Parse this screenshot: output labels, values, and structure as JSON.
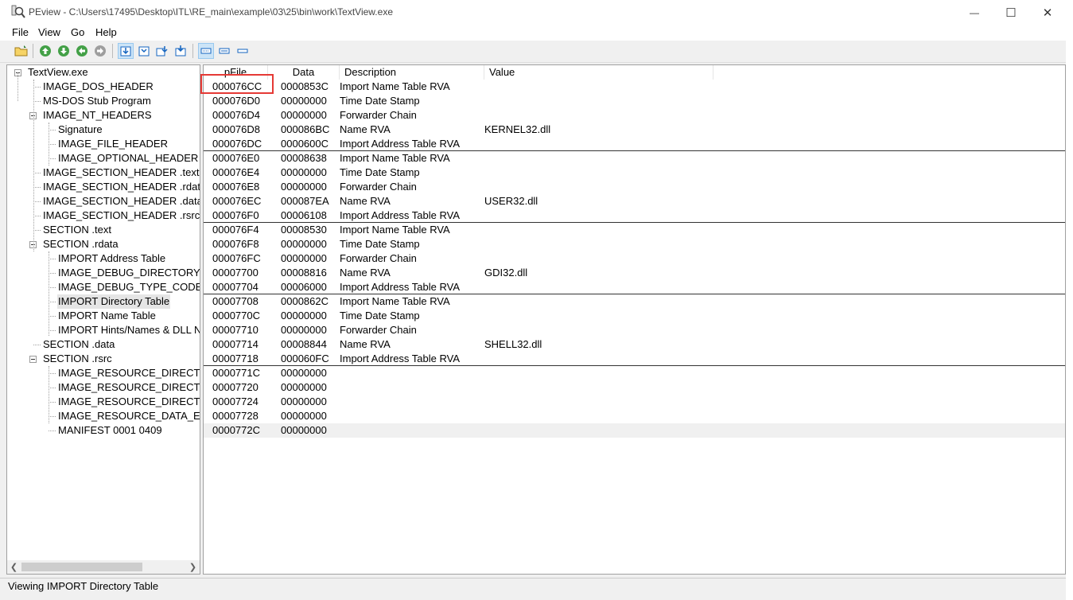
{
  "window": {
    "title": "PEview - C:\\Users\\17495\\Desktop\\ITL\\RE_main\\example\\03\\25\\bin\\work\\TextView.exe",
    "minimize_glyph": "—",
    "maximize_glyph": "☐",
    "close_glyph": "✕"
  },
  "menu": {
    "file": "File",
    "view": "View",
    "go": "Go",
    "help": "Help"
  },
  "toolbar": {
    "icons": [
      "open-folder-icon",
      "go-up-icon",
      "go-down-icon",
      "go-back-icon",
      "go-forward-icon",
      "view-hex-byte-icon",
      "view-hex-word-icon",
      "view-hex-dword-icon",
      "view-hex-qword-icon",
      "view-list-icon",
      "view-small-icon",
      "view-details-icon"
    ],
    "accent": "#2e7d32"
  },
  "tree": {
    "items": [
      {
        "label": "TextView.exe"
      },
      {
        "label": "IMAGE_DOS_HEADER"
      },
      {
        "label": "MS-DOS Stub Program"
      },
      {
        "label": "IMAGE_NT_HEADERS"
      },
      {
        "label": "Signature"
      },
      {
        "label": "IMAGE_FILE_HEADER"
      },
      {
        "label": "IMAGE_OPTIONAL_HEADER"
      },
      {
        "label": "IMAGE_SECTION_HEADER .text"
      },
      {
        "label": "IMAGE_SECTION_HEADER .rdata"
      },
      {
        "label": "IMAGE_SECTION_HEADER .data"
      },
      {
        "label": "IMAGE_SECTION_HEADER .rsrc"
      },
      {
        "label": "SECTION .text"
      },
      {
        "label": "SECTION .rdata"
      },
      {
        "label": "IMPORT Address Table"
      },
      {
        "label": "IMAGE_DEBUG_DIRECTORY"
      },
      {
        "label": "IMAGE_DEBUG_TYPE_CODEVIEW"
      },
      {
        "label": "IMPORT Directory Table"
      },
      {
        "label": "IMPORT Name Table"
      },
      {
        "label": "IMPORT Hints/Names & DLL Names"
      },
      {
        "label": "SECTION .data"
      },
      {
        "label": "SECTION .rsrc"
      },
      {
        "label": "IMAGE_RESOURCE_DIRECTORY Type"
      },
      {
        "label": "IMAGE_RESOURCE_DIRECTORY NameID"
      },
      {
        "label": "IMAGE_RESOURCE_DIRECTORY Language"
      },
      {
        "label": "IMAGE_RESOURCE_DATA_ENTRY"
      },
      {
        "label": "MANIFEST  0001  0409"
      }
    ],
    "selected": "IMPORT Directory Table"
  },
  "list": {
    "columns": [
      "pFile",
      "Data",
      "Description",
      "Value"
    ],
    "rows": [
      {
        "pfile": "000076CC",
        "data": "0000853C",
        "desc": "Import Name Table RVA",
        "value": ""
      },
      {
        "pfile": "000076D0",
        "data": "00000000",
        "desc": "Time Date Stamp",
        "value": ""
      },
      {
        "pfile": "000076D4",
        "data": "00000000",
        "desc": "Forwarder Chain",
        "value": ""
      },
      {
        "pfile": "000076D8",
        "data": "000086BC",
        "desc": "Name RVA",
        "value": "KERNEL32.dll"
      },
      {
        "pfile": "000076DC",
        "data": "0000600C",
        "desc": "Import Address Table RVA",
        "value": ""
      },
      {
        "pfile": "000076E0",
        "data": "00008638",
        "desc": "Import Name Table RVA",
        "value": ""
      },
      {
        "pfile": "000076E4",
        "data": "00000000",
        "desc": "Time Date Stamp",
        "value": ""
      },
      {
        "pfile": "000076E8",
        "data": "00000000",
        "desc": "Forwarder Chain",
        "value": ""
      },
      {
        "pfile": "000076EC",
        "data": "000087EA",
        "desc": "Name RVA",
        "value": "USER32.dll"
      },
      {
        "pfile": "000076F0",
        "data": "00006108",
        "desc": "Import Address Table RVA",
        "value": ""
      },
      {
        "pfile": "000076F4",
        "data": "00008530",
        "desc": "Import Name Table RVA",
        "value": ""
      },
      {
        "pfile": "000076F8",
        "data": "00000000",
        "desc": "Time Date Stamp",
        "value": ""
      },
      {
        "pfile": "000076FC",
        "data": "00000000",
        "desc": "Forwarder Chain",
        "value": ""
      },
      {
        "pfile": "00007700",
        "data": "00008816",
        "desc": "Name RVA",
        "value": "GDI32.dll"
      },
      {
        "pfile": "00007704",
        "data": "00006000",
        "desc": "Import Address Table RVA",
        "value": ""
      },
      {
        "pfile": "00007708",
        "data": "0000862C",
        "desc": "Import Name Table RVA",
        "value": ""
      },
      {
        "pfile": "0000770C",
        "data": "00000000",
        "desc": "Time Date Stamp",
        "value": ""
      },
      {
        "pfile": "00007710",
        "data": "00000000",
        "desc": "Forwarder Chain",
        "value": ""
      },
      {
        "pfile": "00007714",
        "data": "00008844",
        "desc": "Name RVA",
        "value": "SHELL32.dll"
      },
      {
        "pfile": "00007718",
        "data": "000060FC",
        "desc": "Import Address Table RVA",
        "value": ""
      },
      {
        "pfile": "0000771C",
        "data": "00000000",
        "desc": "",
        "value": ""
      },
      {
        "pfile": "00007720",
        "data": "00000000",
        "desc": "",
        "value": ""
      },
      {
        "pfile": "00007724",
        "data": "00000000",
        "desc": "",
        "value": ""
      },
      {
        "pfile": "00007728",
        "data": "00000000",
        "desc": "",
        "value": ""
      },
      {
        "pfile": "0000772C",
        "data": "00000000",
        "desc": "",
        "value": ""
      }
    ],
    "highlighted_pfile": "0000772C",
    "annotated_pfile": "000076CC"
  },
  "status": {
    "text": "Viewing IMPORT Directory Table"
  }
}
